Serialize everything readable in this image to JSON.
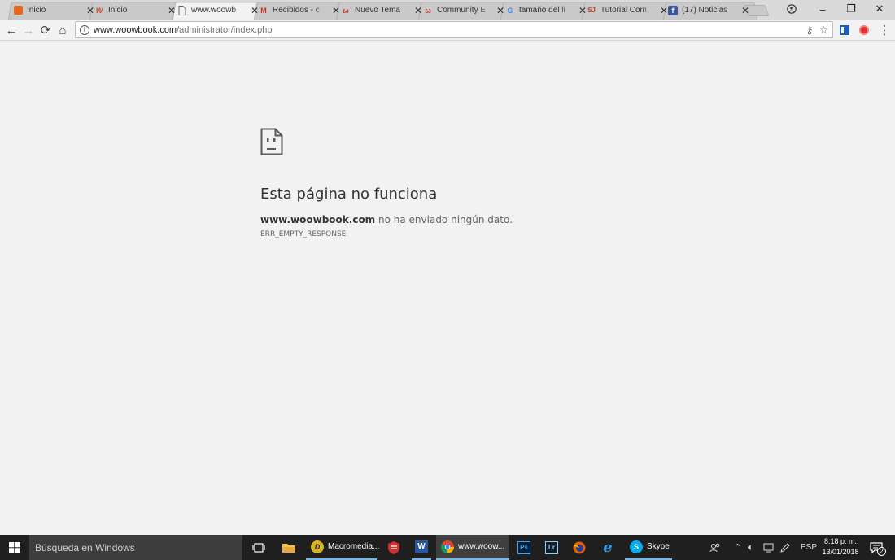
{
  "browser": {
    "tabs": [
      {
        "title": "Inicio",
        "favicon": "orange-square-icon",
        "color": "#e8651c"
      },
      {
        "title": "Inicio",
        "favicon": "w-logo-icon",
        "color": "#d14b2a"
      },
      {
        "title": "www.woowb",
        "favicon": "page-icon",
        "color": "#666666",
        "active": true
      },
      {
        "title": "Recibidos - c",
        "favicon": "gmail-icon",
        "color": "#d93025"
      },
      {
        "title": "Nuevo Tema",
        "favicon": "woowbook-icon",
        "color": "#c0392b"
      },
      {
        "title": "Community E",
        "favicon": "woowbook-icon",
        "color": "#c0392b"
      },
      {
        "title": "tamaño del li",
        "favicon": "google-icon",
        "color": "#4285f4"
      },
      {
        "title": "Tutorial Com",
        "favicon": "sj-icon",
        "color": "#c0392b"
      },
      {
        "title": "(17) Noticias",
        "favicon": "facebook-icon",
        "color": "#3b5998"
      }
    ],
    "window_buttons": {
      "profile": "👤",
      "minimize": "–",
      "restore": "❐",
      "close": "✕"
    },
    "toolbar": {
      "back": "←",
      "forward": "→",
      "reload": "⟳",
      "home": "⌂",
      "url_host": "www.woowbook.com",
      "url_path": "/administrator/index.php",
      "key_icon": "⚷",
      "star_icon": "☆",
      "menu_icon": "⋮"
    }
  },
  "error": {
    "title": "Esta página no funciona",
    "host": "www.woowbook.com",
    "message": " no ha enviado ningún dato.",
    "code": "ERR_EMPTY_RESPONSE"
  },
  "taskbar": {
    "search_placeholder": "Búsqueda en Windows",
    "apps": [
      {
        "label": "Macromedia...",
        "icon": "dreamweaver-icon",
        "color": "#d8b324"
      },
      {
        "label": "www.woow...",
        "icon": "chrome-icon",
        "color": "#4285f4"
      },
      {
        "label": "Skype",
        "icon": "skype-icon",
        "color": "#00aff0"
      }
    ],
    "tray": {
      "language": "ESP",
      "time": "8:18 p. m.",
      "date": "13/01/2018",
      "notifications": "2"
    }
  }
}
